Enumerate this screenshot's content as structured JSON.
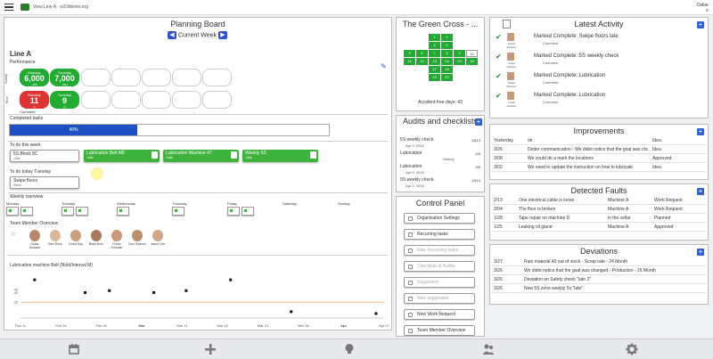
{
  "topbar": {
    "site": "View Line A - w3.tfdemo.org",
    "user_name": "Oskar",
    "user_sub": "≡"
  },
  "planning": {
    "title": "Planning Board",
    "week_label": "Current Week",
    "line": "Line A",
    "performance_label": "Performance",
    "safety_row": "Safety",
    "time_row": "Time",
    "kpis": [
      {
        "day": "Monday",
        "value": "6,000",
        "sub": "+250",
        "color": "#22aa33"
      },
      {
        "day": "Tuesday",
        "value": "7,000",
        "sub": "+500",
        "color": "#22aa33"
      },
      {
        "day": "Monday",
        "value": "11",
        "sub": "+4",
        "color": "#dd3333"
      },
      {
        "day": "Tuesday",
        "value": "9",
        "sub": "+2",
        "color": "#22aa33"
      }
    ],
    "comment_label": "Comment",
    "completed_label": "Completed tasks",
    "progress_text": "40%",
    "progress_value": 40,
    "todo_week_label": "To do this week",
    "todo_week_card": "5S Block 8C",
    "todo_week_card_sub": "Jutta",
    "green_cards": [
      {
        "label": "Lubrication Belt M8",
        "sub": "Jutta"
      },
      {
        "label": "Lubrication Machine 47",
        "sub": "Jutta"
      },
      {
        "label": "Weekly 5S",
        "sub": "Jutta"
      }
    ],
    "todo_today_label": "To do today Tuesday",
    "todo_today_card": "Swipe floors",
    "todo_today_card_sub": "Shola",
    "weekly_label": "Weekly overview",
    "days": [
      "Monday",
      "Tuesday",
      "Wednesday",
      "Thursday",
      "Friday",
      "Saturday",
      "Sunday"
    ],
    "team_label": "Team Member Overview",
    "team": [
      "Oskar Dickson",
      "Ben Ross",
      "Grant Day",
      "Brian Arno",
      "Fredo Frendan",
      "Dan Geaves",
      "Jason Lee"
    ],
    "chart_title": "Lubrication machine Belt (Nold/Interval M)"
  },
  "chart_data": {
    "type": "scatter",
    "title": "Lubrication machine Belt (Nold/Interval M)",
    "categories": [
      "Feb 11",
      "Feb 16",
      "Feb 26",
      "Mar",
      "Mar 11",
      "Mar 16",
      "Mar 21",
      "Mar 28",
      "Apr",
      "Apr 07"
    ],
    "x": [
      0.35,
      1.6,
      2.2,
      3.3,
      4.1,
      5.2,
      6.7,
      8.8
    ],
    "values": [
      60,
      40,
      43,
      40,
      43,
      60,
      10,
      7
    ],
    "yticks": [
      "25",
      "40",
      "45"
    ],
    "target_line": 25,
    "ylim": [
      0,
      70
    ]
  },
  "greencross": {
    "title": "The Green Cross - ...",
    "days": [
      "1",
      "2",
      "3",
      "4",
      "5",
      "6",
      "7",
      "8",
      "9",
      "10",
      "11",
      "12",
      "13",
      "14",
      "15",
      "16",
      "17",
      "18",
      "19",
      "20",
      "21",
      "22",
      "23",
      "24",
      "25",
      "26",
      "27",
      "28",
      "29",
      "30",
      "31"
    ],
    "accident_free": "Accident-free days: 43"
  },
  "audits": {
    "title": "Audits and checklists",
    "rows": [
      {
        "label": "5S weekly check",
        "count": "13/13",
        "date": "Apr 9, 2019",
        "sub": "History"
      },
      {
        "label": "Lubrication",
        "count": "0/9",
        "date": "",
        "sub": "History"
      },
      {
        "label": "Lubrication",
        "count": "0/9",
        "date": "Apr 9, 2019",
        "sub": "History"
      },
      {
        "label": "5S weekly check",
        "count": "13/13",
        "date": "Apr 2, 2019",
        "sub": "History"
      }
    ]
  },
  "control": {
    "title": "Control Panel",
    "items": [
      {
        "label": "Organisation Settings",
        "dim": false
      },
      {
        "label": "Recurring tasks",
        "dim": false
      },
      {
        "label": "New Recurring tasks",
        "dim": true
      },
      {
        "label": "Checklists & Audits",
        "dim": true
      },
      {
        "label": "Suggested",
        "dim": true
      },
      {
        "label": "New suggestion",
        "dim": true
      },
      {
        "label": "New Work Request",
        "dim": false
      },
      {
        "label": "Team Member Overview",
        "dim": false
      }
    ]
  },
  "activity": {
    "title": "Latest Activity",
    "items": [
      {
        "name": "Oskar Dickson",
        "text": "Marked Complete: Swipe floors late",
        "comment": "Comment"
      },
      {
        "name": "Oskar Dickson",
        "text": "Marked Complete: 5S weekly check",
        "comment": "Comment"
      },
      {
        "name": "Oskar Dickson",
        "text": "Marked Complete: Lubrication",
        "comment": "Comment"
      },
      {
        "name": "Oskar Dickson",
        "text": "Marked Complete: Lubrication",
        "comment": "Comment"
      }
    ]
  },
  "improvements": {
    "title": "Improvements",
    "rows": [
      {
        "date": "Yesterday",
        "text": "ok",
        "status": "Idea"
      },
      {
        "date": "3/26",
        "text": "Detter communication - We didnt notice that the goal was changed",
        "status": "Idea"
      },
      {
        "date": "3/08",
        "text": "We could do a mark the locations",
        "status": "Approved"
      },
      {
        "date": "3/02",
        "text": "We need to update the instruction on how to lubricate",
        "status": "Idea"
      }
    ]
  },
  "faults": {
    "title": "Detected Faults",
    "rows": [
      {
        "date": "2/13",
        "text": "One electrical cable is loose",
        "where": "Machine A",
        "status": "Work Request"
      },
      {
        "date": "2/04",
        "text": "The floor is broken",
        "where": "Machine A",
        "status": "Work Request"
      },
      {
        "date": "1/28",
        "text": "Tape repair on machine D",
        "where": "in the cellar",
        "status": "Planned"
      },
      {
        "date": "1/25",
        "text": "Leaking oil gland",
        "where": "Machine A",
        "status": "Approved"
      }
    ]
  },
  "deviations": {
    "title": "Deviations",
    "rows": [
      {
        "date": "3/27",
        "text": "Rain material 40 out of stock - Scrap rate - 24 Month"
      },
      {
        "date": "3/26",
        "text": "We didnt notice that the goal was changed - Production - 26 Month"
      },
      {
        "date": "3/26",
        "text": "Deviation on Safety check \"late 2\""
      },
      {
        "date": "3/26",
        "text": "New 5S zone weekly 5s \"late\""
      }
    ]
  },
  "colors": {
    "accent": "#2f5fd0",
    "green": "#22aa33",
    "red": "#dd3333",
    "progress": "#1f4fc4"
  }
}
